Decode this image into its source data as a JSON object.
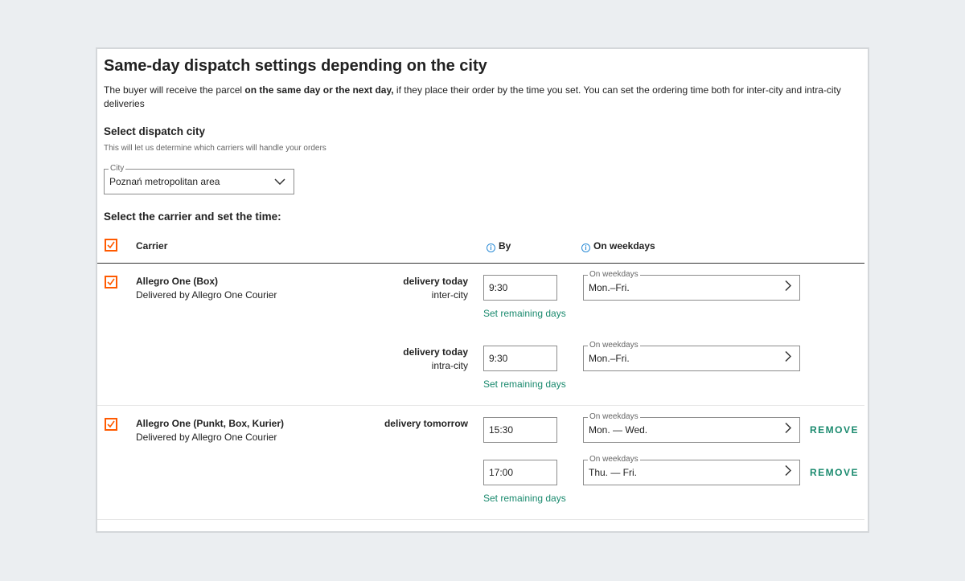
{
  "page": {
    "title": "Same-day dispatch settings depending on the city",
    "desc_pre": "The buyer will receive the parcel ",
    "desc_bold": "on the same day or the next day,",
    "desc_post": " if they place their order by the time you set. You can set the ordering time both for inter-city and intra-city deliveries"
  },
  "dispatch_city": {
    "heading": "Select dispatch city",
    "hint": "This will let us determine which carriers will handle your orders",
    "field_label": "City",
    "value": "Poznań metropolitan area"
  },
  "carriers_section": {
    "heading": "Select the carrier and set the time:",
    "col_carrier": "Carrier",
    "col_by": "By",
    "col_weekdays": "On weekdays"
  },
  "carriers": [
    {
      "name": "Allegro One (Box)",
      "sub": "Delivered by Allegro One Courier",
      "rows": [
        {
          "delivery": "delivery today",
          "type": "inter-city",
          "time": "9:30",
          "weekdays_label": "On weekdays",
          "weekdays": "Mon.–Fri.",
          "link": "Set remaining days"
        },
        {
          "delivery": "delivery today",
          "type": "intra-city",
          "time": "9:30",
          "weekdays_label": "On weekdays",
          "weekdays": "Mon.–Fri.",
          "link": "Set remaining days"
        }
      ]
    },
    {
      "name": "Allegro One (Punkt, Box, Kurier)",
      "sub": "Delivered by Allegro One Courier",
      "delivery": "delivery tomorrow",
      "rows": [
        {
          "time": "15:30",
          "weekdays_label": "On weekdays",
          "weekdays": "Mon. — Wed.",
          "remove": "REMOVE"
        },
        {
          "time": "17:00",
          "weekdays_label": "On weekdays",
          "weekdays": "Thu. — Fri.",
          "remove": "REMOVE"
        }
      ],
      "link": "Set remaining days"
    }
  ],
  "colors": {
    "accent_orange": "#ff5a00",
    "link_green": "#1a8a6e",
    "info_blue": "#2a8bd6"
  },
  "icons": {
    "checkbox": "checkmark-icon",
    "dropdown": "chevron-down-icon",
    "weekday_picker": "chevron-right-icon",
    "column_info": "info-icon"
  }
}
